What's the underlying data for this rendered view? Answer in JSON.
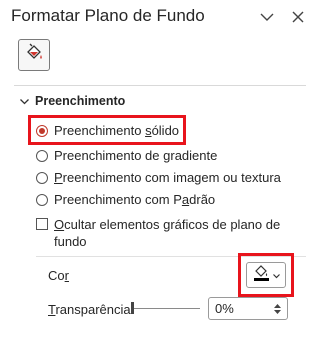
{
  "pane": {
    "title": "Formatar Plano de Fundo",
    "icons": {
      "options": "chevron-down-icon",
      "close": "close-icon",
      "fill_tab": "paint-bucket-icon"
    }
  },
  "section": {
    "label": "Preenchimento",
    "icon": "chevron-down-icon"
  },
  "options": [
    {
      "pre": "Preenchimento ",
      "ul": "s",
      "post": "ólido",
      "selected": true
    },
    {
      "pre": "Preenchimento de ",
      "ul": "g",
      "post": "radiente",
      "selected": false
    },
    {
      "pre": "",
      "ul": "P",
      "post": "reenchimento com imagem ou textura",
      "selected": false
    },
    {
      "pre": "Preenchimento com P",
      "ul": "a",
      "post": "drão",
      "selected": false
    }
  ],
  "hide_graphics": {
    "line1_ul": "O",
    "line1_rest": "cultar elementos gráficos de plano de",
    "line2": "fundo",
    "checked": false
  },
  "color": {
    "pre": "Co",
    "ul": "r",
    "post": "",
    "swatch": "#000000"
  },
  "transparency": {
    "ul": "T",
    "rest": "ransparência",
    "value": "0%",
    "slider_fraction": 0
  },
  "highlight_color": "#e8141c",
  "accent_color": "#c0392b"
}
